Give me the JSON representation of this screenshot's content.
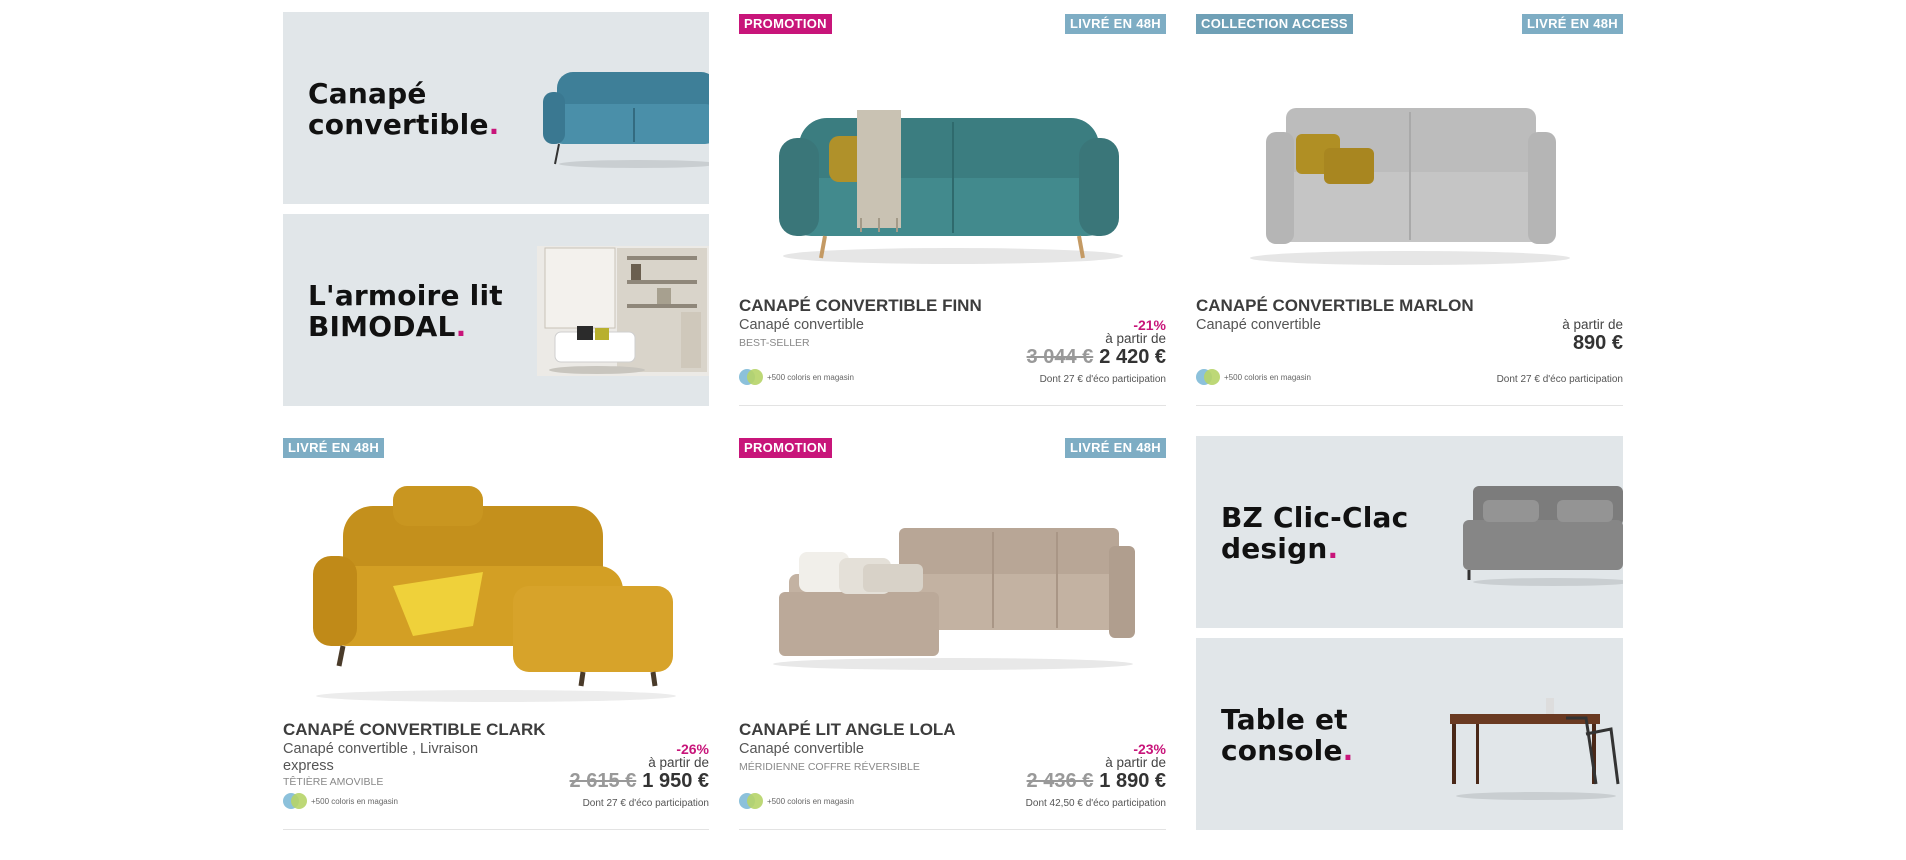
{
  "banners": [
    {
      "line1": "Canapé",
      "line2": "convertible"
    },
    {
      "line1": "L'armoire lit",
      "line2": "BIMODAL"
    },
    {
      "line1": "BZ Clic-Clac",
      "line2": "design"
    },
    {
      "line1": "Table et",
      "line2": "console"
    }
  ],
  "banner_dot": ".",
  "products": [
    {
      "badge_left": "PROMOTION",
      "badge_right": "LIVRÉ EN 48H",
      "name": "CANAPÉ CONVERTIBLE FINN",
      "category": "Canapé convertible",
      "note": "BEST-SELLER",
      "stock": "+500 coloris en magasin",
      "discount": "-21%",
      "from_label": "à partir de",
      "old_price": "3 044 €",
      "price": "2 420 €",
      "eco": "Dont 27 € d'éco participation"
    },
    {
      "badge_left": "COLLECTION ACCESS",
      "badge_right": "LIVRÉ EN 48H",
      "name": "CANAPÉ CONVERTIBLE MARLON",
      "category": "Canapé convertible",
      "note": "",
      "stock": "+500 coloris en magasin",
      "discount": "",
      "from_label": "à partir de",
      "old_price": "",
      "price": "890 €",
      "eco": "Dont 27 € d'éco participation"
    },
    {
      "badge_left": "LIVRÉ EN 48H",
      "badge_right": "",
      "name": "CANAPÉ CONVERTIBLE CLARK",
      "category": "Canapé convertible , Livraison express",
      "note": "TÊTIÈRE AMOVIBLE",
      "stock": "+500 coloris en magasin",
      "discount": "-26%",
      "from_label": "à partir de",
      "old_price": "2 615 €",
      "price": "1 950 €",
      "eco": "Dont 27 € d'éco participation"
    },
    {
      "badge_left": "PROMOTION",
      "badge_right": "LIVRÉ EN 48H",
      "name": "CANAPÉ LIT ANGLE LOLA",
      "category": "Canapé convertible",
      "note": "MÉRIDIENNE COFFRE RÉVERSIBLE",
      "stock": "+500 coloris en magasin",
      "discount": "-23%",
      "from_label": "à partir de",
      "old_price": "2 436 €",
      "price": "1 890 €",
      "eco": "Dont 42,50 € d'éco participation"
    }
  ],
  "colors": {
    "accent": "#c8157a",
    "badge_blue": "#7eadc4",
    "banner_bg": "#e1e6e9"
  },
  "icons": [
    "sofa-image",
    "armoire-bed-image",
    "clic-clac-image",
    "table-image",
    "color-swatch-icon"
  ]
}
